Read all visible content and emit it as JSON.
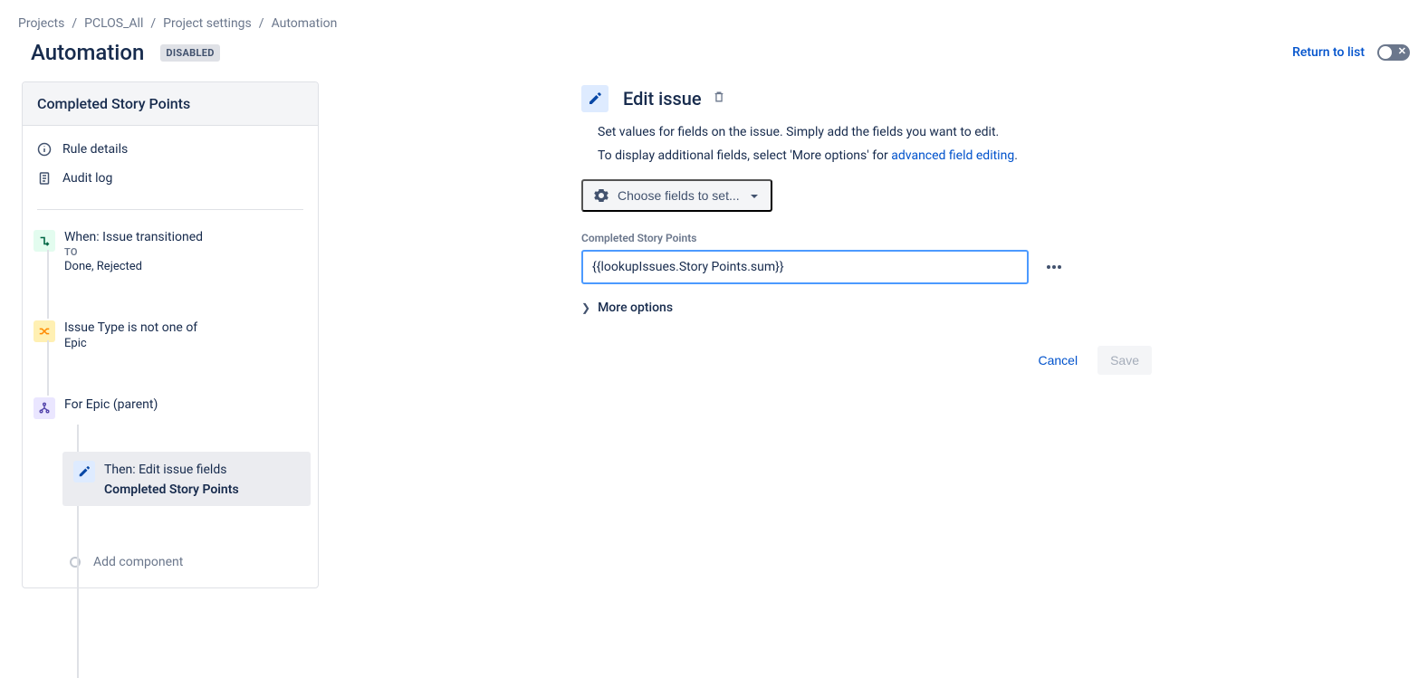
{
  "breadcrumbs": {
    "items": [
      "Projects",
      "PCLOS_All",
      "Project settings",
      "Automation"
    ]
  },
  "header": {
    "title": "Automation",
    "status": "DISABLED",
    "return_label": "Return to list"
  },
  "sidebar": {
    "rule_name": "Completed Story Points",
    "nav": {
      "rule_details": "Rule details",
      "audit_log": "Audit log"
    },
    "steps": {
      "trigger": {
        "title": "When: Issue transitioned",
        "sub_label": "TO",
        "sub_text": "Done, Rejected"
      },
      "condition": {
        "title": "Issue Type is not one of",
        "sub_text": "Epic"
      },
      "branch": {
        "title": "For Epic (parent)"
      },
      "action": {
        "title": "Then: Edit issue fields",
        "field": "Completed Story Points"
      },
      "add_component": "Add component"
    }
  },
  "detail": {
    "title": "Edit issue",
    "desc1": "Set values for fields on the issue. Simply add the fields you want to edit.",
    "desc2a": "To display additional fields, select 'More options' for ",
    "desc2_link": "advanced field editing",
    "choose_fields": "Choose fields to set...",
    "field_label": "Completed Story Points",
    "field_value": "{{lookupIssues.Story Points.sum}}",
    "more_options": "More options",
    "cancel": "Cancel",
    "save": "Save"
  }
}
